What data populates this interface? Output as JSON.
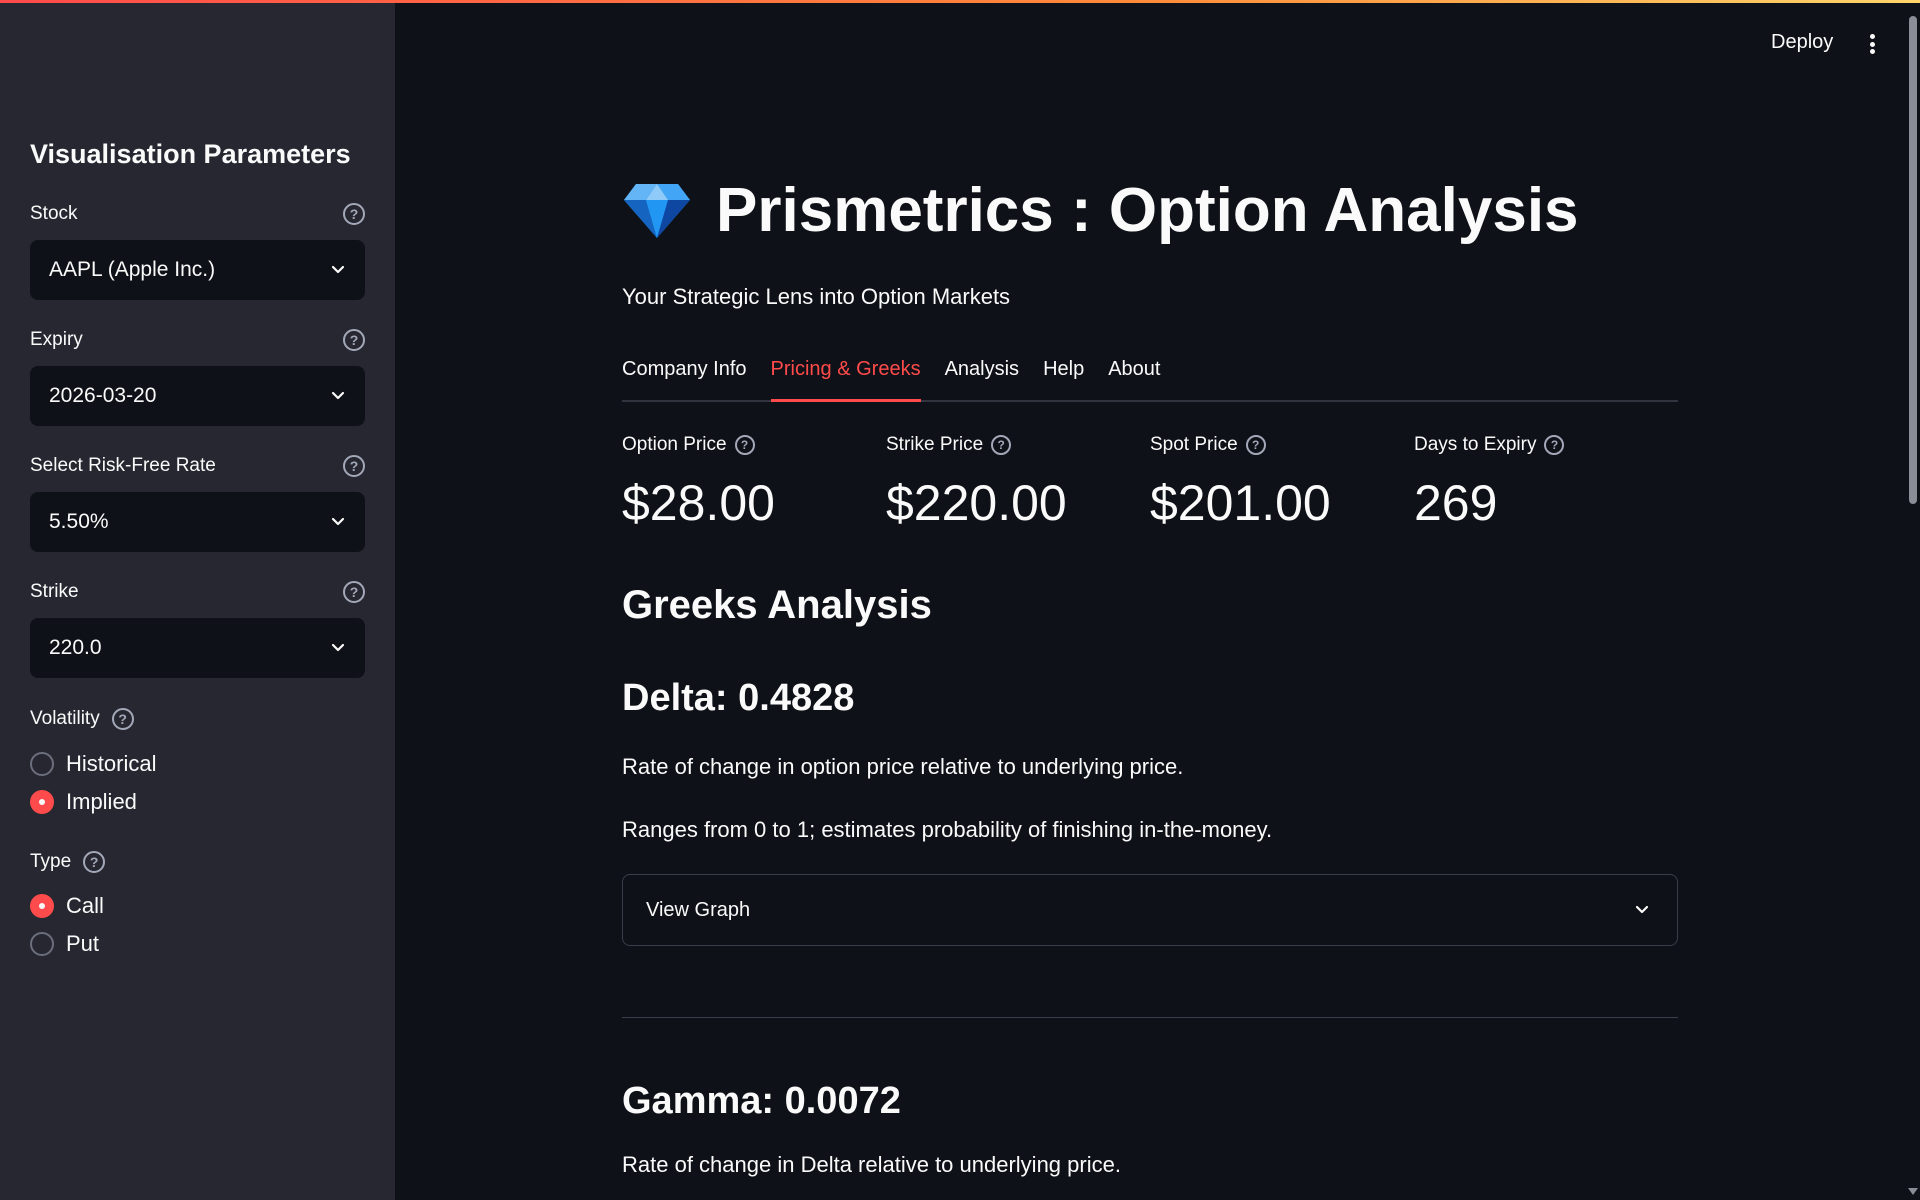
{
  "sidebar": {
    "title": "Visualisation Parameters",
    "fields": [
      {
        "label": "Stock",
        "value": "AAPL (Apple Inc.)"
      },
      {
        "label": "Expiry",
        "value": "2026-03-20"
      },
      {
        "label": "Select Risk-Free Rate",
        "value": "5.50%"
      },
      {
        "label": "Strike",
        "value": "220.0"
      }
    ],
    "volatility": {
      "label": "Volatility",
      "options": [
        {
          "label": "Historical",
          "selected": false
        },
        {
          "label": "Implied",
          "selected": true
        }
      ]
    },
    "type": {
      "label": "Type",
      "options": [
        {
          "label": "Call",
          "selected": true
        },
        {
          "label": "Put",
          "selected": false
        }
      ]
    }
  },
  "header": {
    "deploy_label": "Deploy"
  },
  "main": {
    "title": "Prismetrics : Option Analysis",
    "subtitle": "Your Strategic Lens into Option Markets",
    "tabs": [
      {
        "label": "Company Info",
        "active": false
      },
      {
        "label": "Pricing & Greeks",
        "active": true
      },
      {
        "label": "Analysis",
        "active": false
      },
      {
        "label": "Help",
        "active": false
      },
      {
        "label": "About",
        "active": false
      }
    ],
    "metrics": [
      {
        "label": "Option Price",
        "value": "$28.00"
      },
      {
        "label": "Strike Price",
        "value": "$220.00"
      },
      {
        "label": "Spot Price",
        "value": "$201.00"
      },
      {
        "label": "Days to Expiry",
        "value": "269"
      }
    ],
    "section_heading": "Greeks Analysis",
    "delta": {
      "heading": "Delta: 0.4828",
      "desc1": "Rate of change in option price relative to underlying price.",
      "desc2": "Ranges from 0 to 1; estimates probability of finishing in-the-money.",
      "expander_label": "View Graph"
    },
    "gamma": {
      "heading": "Gamma: 0.0072",
      "desc1": "Rate of change in Delta relative to underlying price."
    }
  },
  "colors": {
    "accent": "#ff4b4b",
    "background": "#0e1117",
    "sidebar": "#262730"
  }
}
